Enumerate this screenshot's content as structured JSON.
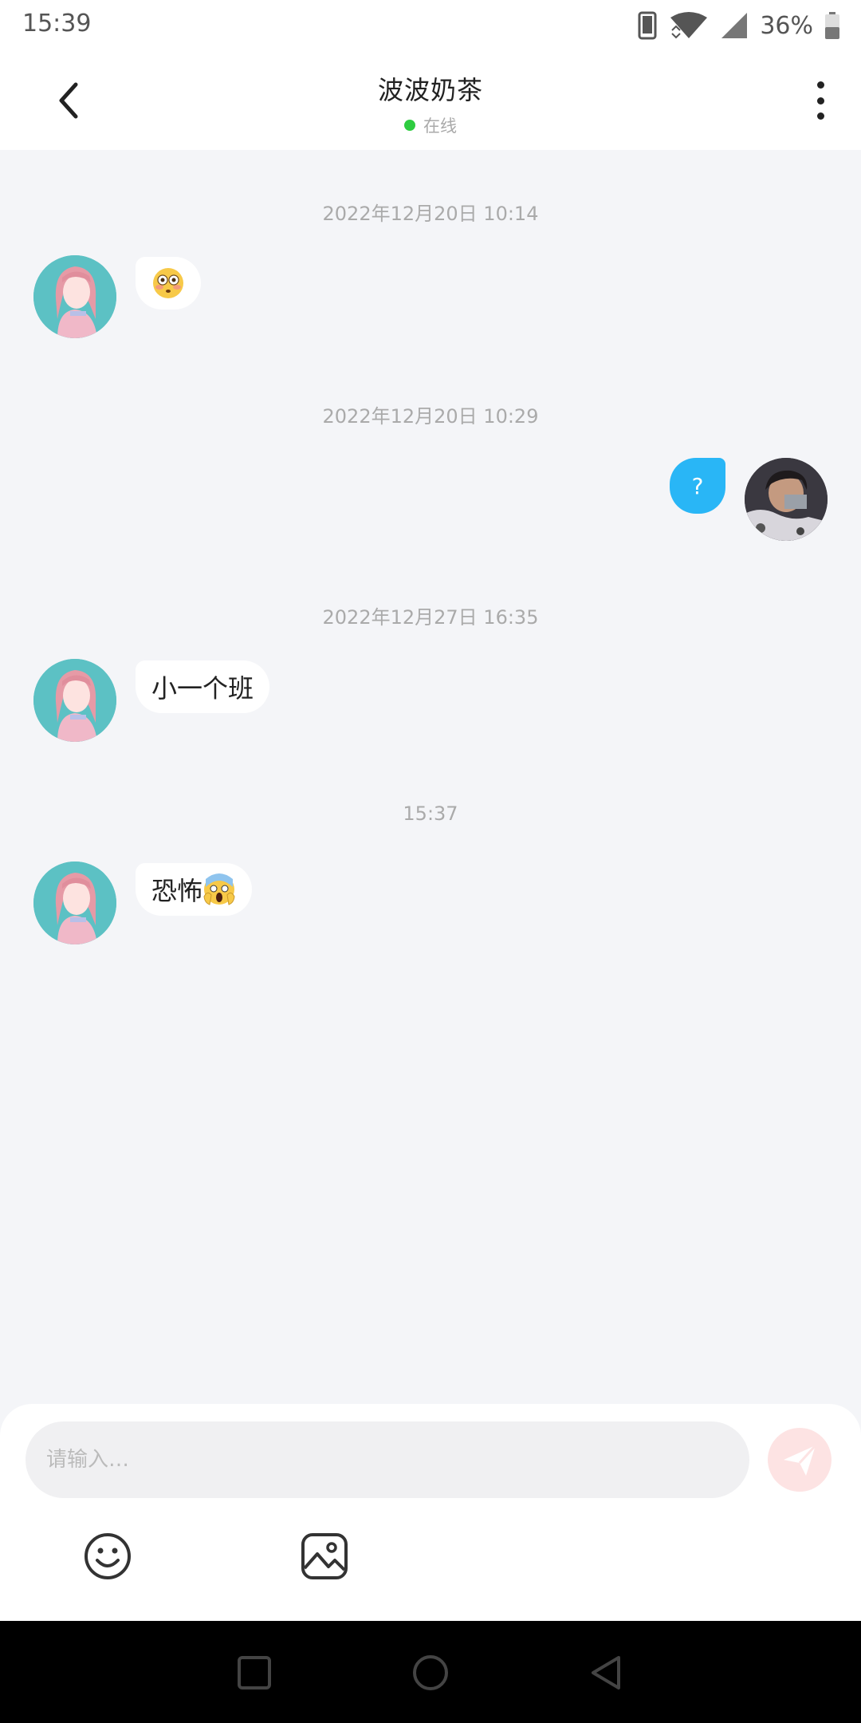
{
  "status_bar": {
    "time": "15:39",
    "battery": "36%",
    "icons": [
      "phone-icon",
      "wifi-icon",
      "signal-icon",
      "battery-icon"
    ]
  },
  "header": {
    "title": "波波奶茶",
    "status": "在线",
    "status_color": "#2ecc40",
    "back_icon": "chevron-left-icon",
    "more_icon": "more-vertical-icon"
  },
  "messages": [
    {
      "time": "2022年12月20日 10:14",
      "side": "in",
      "text": "",
      "emoji": "flushed-face"
    },
    {
      "time": "2022年12月20日 10:29",
      "side": "out",
      "text": "?"
    },
    {
      "time": "2022年12月27日 16:35",
      "side": "in",
      "text": "小一个班"
    },
    {
      "time": "15:37",
      "side": "in",
      "text": "恐怖",
      "emoji": "screaming-face"
    }
  ],
  "composer": {
    "placeholder": "请输入…",
    "value": "",
    "send_icon": "send-icon",
    "tools": [
      "emoji-icon",
      "image-icon"
    ]
  },
  "nav": {
    "buttons": [
      "recents-button",
      "home-button",
      "back-button"
    ]
  },
  "colors": {
    "accent_blue": "#29b6f6",
    "send_bg": "#fde3e3",
    "background": "#f4f5f8"
  }
}
